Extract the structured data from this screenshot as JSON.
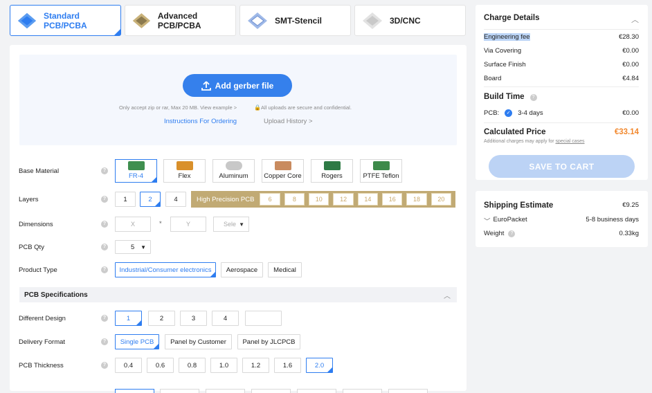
{
  "tabs": [
    {
      "label": "Standard PCB/PCBA",
      "selected": true
    },
    {
      "label": "Advanced PCB/PCBA"
    },
    {
      "label": "SMT-Stencil"
    },
    {
      "label": "3D/CNC"
    }
  ],
  "upload": {
    "button": "Add gerber file",
    "hint_left": "Only accept zip or rar, Max 20 MB. View example >",
    "hint_right": "All uploads are secure and confidential.",
    "link_instructions": "Instructions For Ordering",
    "link_history": "Upload History >"
  },
  "form": {
    "base_material": {
      "label": "Base Material",
      "options": [
        "FR-4",
        "Flex",
        "Aluminum",
        "Copper Core",
        "Rogers",
        "PTFE Teflon"
      ],
      "selected": "FR-4"
    },
    "layers": {
      "label": "Layers",
      "options": [
        "1",
        "2",
        "4"
      ],
      "selected": "2",
      "high_precision_label": "High Precision PCB",
      "hp_options": [
        "6",
        "8",
        "10",
        "12",
        "14",
        "16",
        "18",
        "20"
      ]
    },
    "dimensions": {
      "label": "Dimensions",
      "x_placeholder": "X",
      "sep": "*",
      "y_placeholder": "Y",
      "unit_placeholder": "Sele"
    },
    "pcb_qty": {
      "label": "PCB Qty",
      "value": "5"
    },
    "product_type": {
      "label": "Product Type",
      "options": [
        "Industrial/Consumer electronics",
        "Aerospace",
        "Medical"
      ],
      "selected": "Industrial/Consumer electronics"
    },
    "spec_header": "PCB Specifications",
    "different_design": {
      "label": "Different Design",
      "options": [
        "1",
        "2",
        "3",
        "4",
        ""
      ],
      "selected": "1"
    },
    "delivery_format": {
      "label": "Delivery Format",
      "options": [
        "Single PCB",
        "Panel by Customer",
        "Panel by JLCPCB"
      ],
      "selected": "Single PCB"
    },
    "pcb_thickness": {
      "label": "PCB Thickness",
      "options": [
        "0.4",
        "0.6",
        "0.8",
        "1.0",
        "1.2",
        "1.6",
        "2.0"
      ],
      "selected": "2.0"
    }
  },
  "charge": {
    "title": "Charge Details",
    "rows": [
      {
        "label": "Engineering fee",
        "value": "€28.30"
      },
      {
        "label": "Via Covering",
        "value": "€0.00"
      },
      {
        "label": "Surface Finish",
        "value": "€0.00"
      },
      {
        "label": "Board",
        "value": "€4.84"
      }
    ],
    "build_time_title": "Build Time",
    "pcb_label": "PCB:",
    "build_option": "3-4 days",
    "build_value": "€0.00",
    "price_title": "Calculated Price",
    "price_value": "€33.14",
    "note_prefix": "Additional charges may apply for ",
    "note_link": "special cases",
    "save": "SAVE TO CART"
  },
  "shipping": {
    "title": "Shipping Estimate",
    "value": "€9.25",
    "method": "EuroPacket",
    "days": "5-8 business days",
    "weight_label": "Weight",
    "weight": "0.33kg"
  },
  "colors": {
    "accent": "#2e7df0",
    "price": "#f2892f",
    "gold": "#c1aa74"
  },
  "icons": [
    "pcb-icon",
    "advanced-pcb-icon",
    "stencil-icon",
    "cnc-icon",
    "upload-icon",
    "lock-icon",
    "help-icon",
    "chevron-up-icon",
    "chevron-down-icon",
    "check-icon"
  ]
}
